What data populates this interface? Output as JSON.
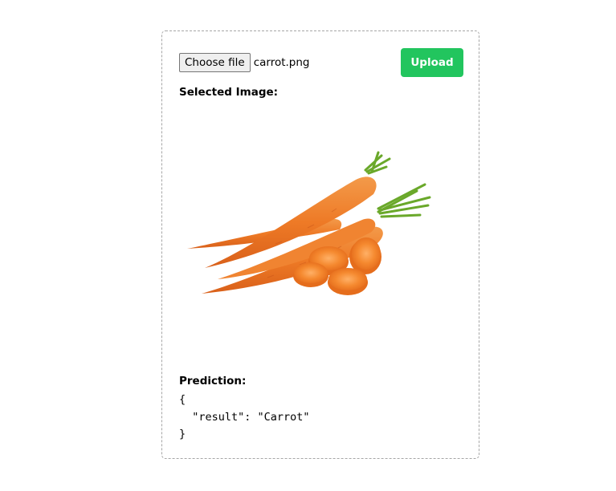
{
  "file_input": {
    "button_label": "Choose file",
    "file_name": "carrot.png"
  },
  "upload": {
    "label": "Upload",
    "color": "#22c55e"
  },
  "selected_image": {
    "label": "Selected Image:",
    "subject": "carrots with sliced rounds"
  },
  "prediction": {
    "label": "Prediction:",
    "json_text": "{\n  \"result\": \"Carrot\"\n}"
  }
}
